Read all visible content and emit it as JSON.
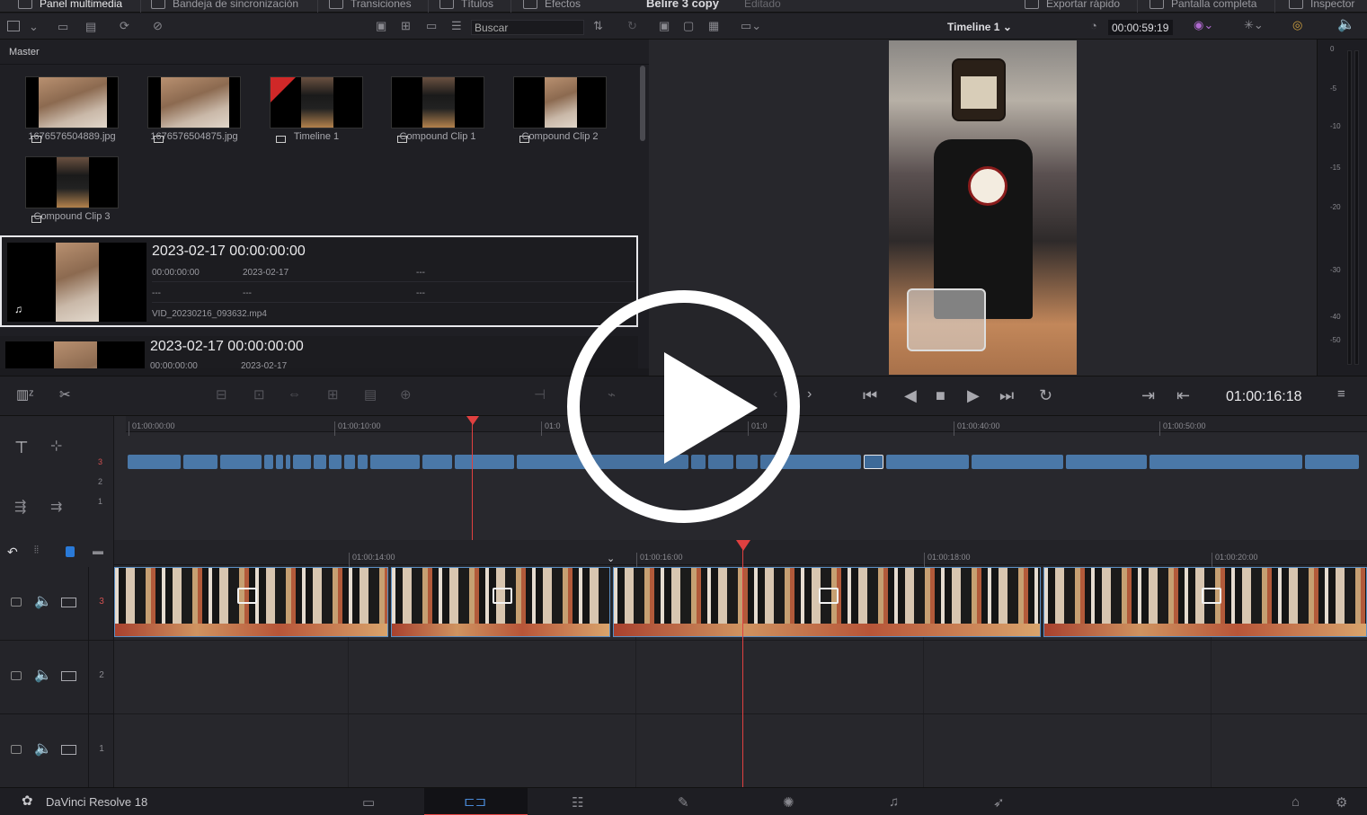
{
  "topbar": {
    "media_pool": "Panel multimedia",
    "sync_bin": "Bandeja de sincronización",
    "transitions": "Transiciones",
    "titles": "Títulos",
    "effects": "Efectos",
    "project_title": "Belire 3 copy",
    "project_status": "Editado",
    "quick_export": "Exportar rápido",
    "fullscreen": "Pantalla completa",
    "inspector": "Inspector"
  },
  "toolbar": {
    "search_placeholder": "Buscar",
    "timeline_name": "Timeline 1",
    "timeline_duration": "00:00:59:19"
  },
  "pool": {
    "bin_name": "Master",
    "clips": [
      {
        "name": "1676576504889.jpg"
      },
      {
        "name": "1676576504875.jpg"
      },
      {
        "name": "Timeline 1"
      },
      {
        "name": "Compound Clip 1"
      },
      {
        "name": "Compound Clip 2"
      },
      {
        "name": "Compound Clip 3"
      }
    ],
    "list": [
      {
        "title": "2023-02-17  00:00:00:00",
        "tc": "00:00:00:00",
        "date": "2023-02-17",
        "dash1": "---",
        "dash2": "---",
        "dash3": "---",
        "dash4": "---",
        "file": "VID_20230216_093632.mp4"
      },
      {
        "title": "2023-02-17  00:00:00:00",
        "tc": "00:00:00:00",
        "date": "2023-02-17"
      }
    ]
  },
  "meter": {
    "labels": [
      "0",
      "-5",
      "-10",
      "-15",
      "-20",
      "-30",
      "-40",
      "-50"
    ]
  },
  "transport": {
    "current_timecode": "01:00:16:18"
  },
  "upper_timeline": {
    "ruler": [
      "01:00:00:00",
      "01:00:10:00",
      "01:0",
      "01:0",
      "01:00:40:00",
      "01:00:50:00"
    ],
    "tracks": [
      "3",
      "2",
      "1"
    ]
  },
  "lower_timeline": {
    "ruler": [
      "01:00:14:00",
      "01:00:16:00",
      "01:00:18:00",
      "01:00:20:00"
    ],
    "tracks": [
      "3",
      "2",
      "1"
    ]
  },
  "pagebar": {
    "app_name": "DaVinci Resolve 18"
  },
  "colors": {
    "accent_red": "#e04040",
    "clip_blue": "#4a78a8",
    "track_active": "#d05050"
  }
}
